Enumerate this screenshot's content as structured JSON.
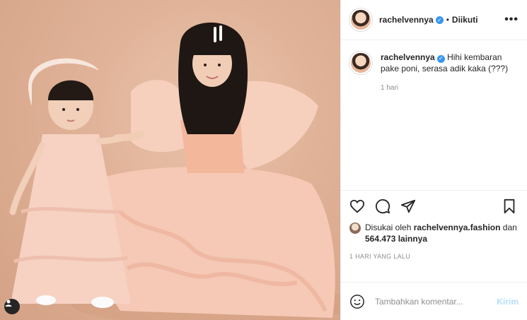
{
  "header": {
    "username": "rachelvennya",
    "separator": "•",
    "follow_status": "Diikuti",
    "more_icon": "more-horizontal-icon"
  },
  "caption": {
    "username": "rachelvennya",
    "text": "Hihi kembaran pake poni, serasa adik kaka (???)",
    "time": "1 hari"
  },
  "actions": {
    "like_icon": "heart-icon",
    "comment_icon": "comment-icon",
    "share_icon": "share-icon",
    "save_icon": "bookmark-icon"
  },
  "likes": {
    "prefix": "Disukai oleh",
    "user": "rachelvennya.fashion",
    "joiner": "dan",
    "count": "564.473 lainnya"
  },
  "post_time": "1 HARI YANG LALU",
  "comment_box": {
    "placeholder": "Tambahkan komentar...",
    "post_label": "Kirim",
    "emoji_icon": "emoji-icon"
  },
  "colors": {
    "verified": "#3897f0",
    "post_button_disabled": "#b2dffc",
    "photo_background": "#dfb196",
    "dress": "#f4c3b0"
  }
}
